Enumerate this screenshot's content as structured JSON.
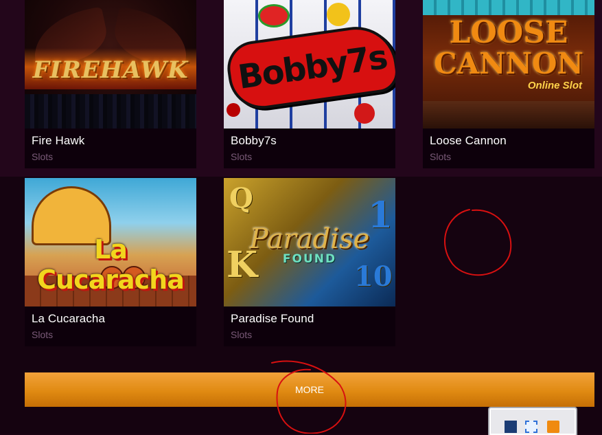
{
  "games": [
    {
      "title": "Fire Hawk",
      "category": "Slots",
      "logo": "FIREHAWK"
    },
    {
      "title": "Bobby7s",
      "category": "Slots",
      "logo": "Bobby7s"
    },
    {
      "title": "Loose Cannon",
      "category": "Slots",
      "logo_line1": "LOOSE",
      "logo_line2": "CANNON",
      "logo_sub": "Online Slot"
    },
    {
      "title": "La Cucaracha",
      "category": "Slots",
      "logo": "La Cucaracha"
    },
    {
      "title": "Paradise Found",
      "category": "Slots",
      "logo_line1": "Paradise",
      "logo_line2": "FOUND"
    }
  ],
  "more_button": {
    "label": "MORE"
  },
  "colors": {
    "background_top": "#23061b",
    "background_bottom": "#150310",
    "card_bg": "#0d000b",
    "category_text": "#7a5a78",
    "button_orange": "#e08a12",
    "annotation_red": "#d81010"
  },
  "taskbar": {
    "icons": [
      "shield-icon",
      "selection-icon",
      "edit-icon"
    ]
  }
}
